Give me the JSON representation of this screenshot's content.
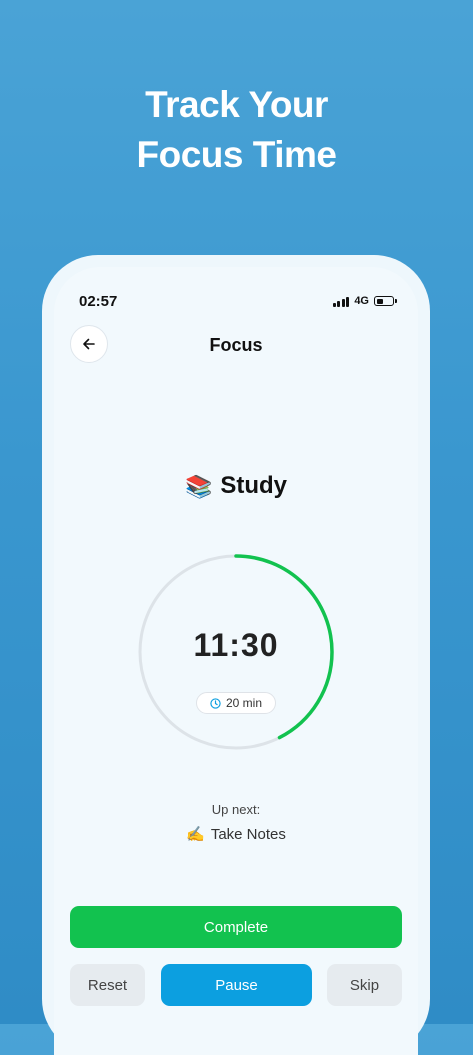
{
  "promo": {
    "line1": "Track Your",
    "line2": "Focus Time"
  },
  "status_bar": {
    "time": "02:57",
    "network": "4G"
  },
  "header": {
    "title": "Focus",
    "back_icon": "arrow-left-icon"
  },
  "session": {
    "task_emoji": "📚",
    "task_name": "Study",
    "timer": "11:30",
    "duration": "20 min",
    "progress_fraction": 0.425,
    "progress_color": "#12c24f",
    "track_color": "#dde3e8"
  },
  "up_next": {
    "label": "Up next:",
    "emoji": "✍️",
    "task": "Take Notes"
  },
  "buttons": {
    "complete": "Complete",
    "reset": "Reset",
    "pause": "Pause",
    "skip": "Skip"
  },
  "colors": {
    "complete": "#12c24f",
    "pause": "#0c9fe0",
    "secondary": "#e6ebef"
  }
}
